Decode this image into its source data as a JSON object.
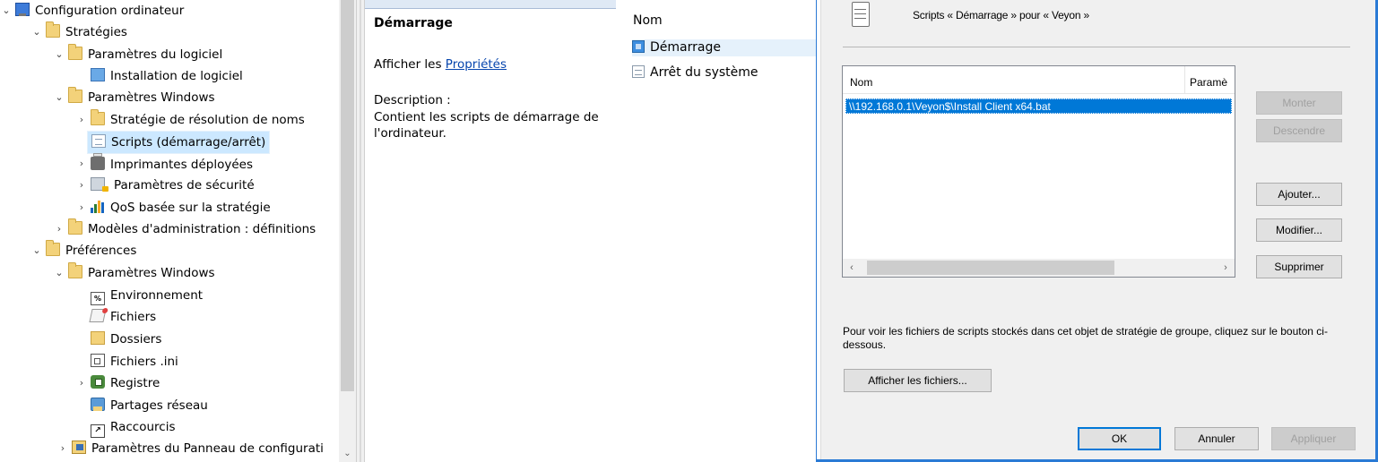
{
  "tree": {
    "items": [
      {
        "label": "Configuration ordinateur",
        "icon": "computer-icon",
        "expander": "expanded"
      },
      {
        "label": "Stratégies",
        "icon": "folder-icon",
        "expander": "expanded"
      },
      {
        "label": "Paramètres du logiciel",
        "icon": "folder-icon",
        "expander": "expanded"
      },
      {
        "label": "Installation de logiciel",
        "icon": "software-install-icon",
        "expander": "none"
      },
      {
        "label": "Paramètres Windows",
        "icon": "folder-icon",
        "expander": "expanded"
      },
      {
        "label": "Stratégie de résolution de noms",
        "icon": "folder-icon",
        "expander": "collapsed"
      },
      {
        "label": "Scripts (démarrage/arrêt)",
        "icon": "scripts-icon",
        "expander": "none",
        "selected": true
      },
      {
        "label": "Imprimantes déployées",
        "icon": "printer-icon",
        "expander": "collapsed"
      },
      {
        "label": "Paramètres de sécurité",
        "icon": "security-icon",
        "expander": "collapsed"
      },
      {
        "label": "QoS basée sur la stratégie",
        "icon": "qos-chart-icon",
        "expander": "collapsed"
      },
      {
        "label": "Modèles d'administration : définitions",
        "icon": "folder-icon",
        "expander": "collapsed"
      },
      {
        "label": "Préférences",
        "icon": "folder-icon",
        "expander": "expanded"
      },
      {
        "label": "Paramètres Windows",
        "icon": "folder-icon",
        "expander": "expanded"
      },
      {
        "label": "Environnement",
        "icon": "environment-icon",
        "expander": "none"
      },
      {
        "label": "Fichiers",
        "icon": "files-icon",
        "expander": "none"
      },
      {
        "label": "Dossiers",
        "icon": "folders-icon",
        "expander": "none"
      },
      {
        "label": "Fichiers .ini",
        "icon": "ini-file-icon",
        "expander": "none"
      },
      {
        "label": "Registre",
        "icon": "registry-icon",
        "expander": "collapsed"
      },
      {
        "label": "Partages réseau",
        "icon": "network-share-icon",
        "expander": "none"
      },
      {
        "label": "Raccourcis",
        "icon": "shortcut-icon",
        "expander": "none"
      },
      {
        "label": "Paramètres du Panneau de configurati",
        "icon": "control-panel-icon",
        "expander": "collapsed"
      }
    ]
  },
  "extended": {
    "title": "Démarrage",
    "props_prefix": "Afficher les ",
    "props_link": "Propriétés",
    "desc_label": "Description :",
    "desc_text": "Contient les scripts de démarrage de l'ordinateur."
  },
  "list": {
    "column": "Nom",
    "items": [
      {
        "label": "Démarrage",
        "icon": "startup-script-icon",
        "selected": true
      },
      {
        "label": "Arrêt du système",
        "icon": "shutdown-script-icon",
        "selected": false
      }
    ]
  },
  "dialog": {
    "heading": "Scripts « Démarrage » pour « Veyon »",
    "columns": {
      "name": "Nom",
      "params": "Paramè"
    },
    "rows": [
      {
        "name": "\\\\192.168.0.1\\Veyon$\\Install Client x64.bat"
      }
    ],
    "buttons": {
      "up": "Monter",
      "down": "Descendre",
      "add": "Ajouter...",
      "edit": "Modifier...",
      "remove": "Supprimer",
      "show_files": "Afficher les fichiers...",
      "ok": "OK",
      "cancel": "Annuler",
      "apply": "Appliquer"
    },
    "info": "Pour voir les fichiers de scripts stockés dans cet objet de stratégie de groupe, cliquez sur le bouton ci-dessous."
  },
  "colors": {
    "selection": "#0078d7",
    "dialog_border": "#2a7ad5",
    "link": "#0645ad"
  }
}
